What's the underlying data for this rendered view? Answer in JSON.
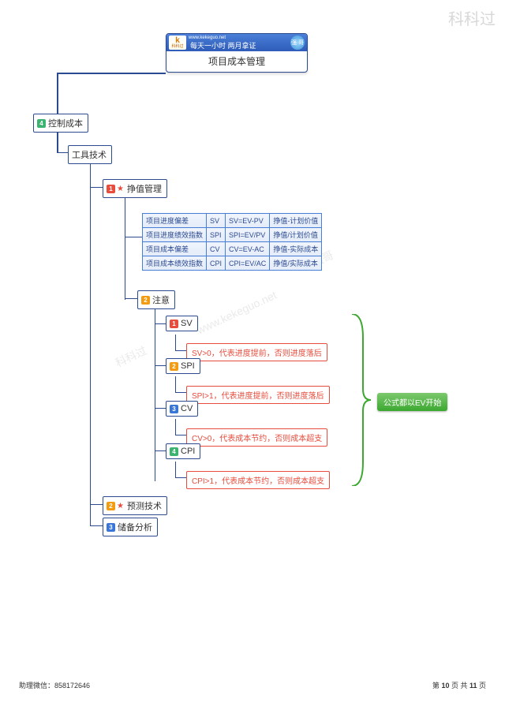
{
  "watermark": {
    "top_right": "科科过",
    "diag": "www.kekeguo.net",
    "brand": "科科过",
    "qiangge": "强哥"
  },
  "title": {
    "brand_letter": "k",
    "brand_cn": "科科过",
    "url": "www.kekeguo.net",
    "slogan": "每天一小时   两月拿证",
    "badge": "强 哥",
    "main": "项目成本管理"
  },
  "tree": {
    "n1": {
      "num": "4",
      "label": "控制成本"
    },
    "n2": {
      "label": "工具技术"
    },
    "n3": {
      "num": "1",
      "label": "挣值管理"
    },
    "table": [
      {
        "c0": "项目进度偏差",
        "c1": "SV",
        "c2": "SV=EV-PV",
        "c3": "挣值-计划价值"
      },
      {
        "c0": "项目进度绩效指数",
        "c1": "SPI",
        "c2": "SPI=EV/PV",
        "c3": "挣值/计划价值"
      },
      {
        "c0": "项目成本偏差",
        "c1": "CV",
        "c2": "CV=EV-AC",
        "c3": "挣值-实际成本"
      },
      {
        "c0": "项目成本绩效指数",
        "c1": "CPI",
        "c2": "CPI=EV/AC",
        "c3": "挣值/实际成本"
      }
    ],
    "n4": {
      "num": "2",
      "label": "注意"
    },
    "sv": {
      "num": "1",
      "label": "SV",
      "desc": "SV>0，代表进度提前，否则进度落后"
    },
    "spi": {
      "num": "2",
      "label": "SPI",
      "desc": "SPI>1，代表进度提前，否则进度落后"
    },
    "cv": {
      "num": "3",
      "label": "CV",
      "desc": "CV>0，代表成本节约，否则成本超支"
    },
    "cpi": {
      "num": "4",
      "label": "CPI",
      "desc": "CPI>1，代表成本节约，否则成本超支"
    },
    "callout": "公式都以EV开始",
    "n5": {
      "num": "2",
      "label": "预测技术"
    },
    "n6": {
      "num": "3",
      "label": "储备分析"
    }
  },
  "footer": {
    "left": "助理微信：858172646",
    "right_prefix": "第 ",
    "right_page": "10",
    "right_mid": " 页 共 ",
    "right_total": "11",
    "right_suffix": " 页"
  }
}
